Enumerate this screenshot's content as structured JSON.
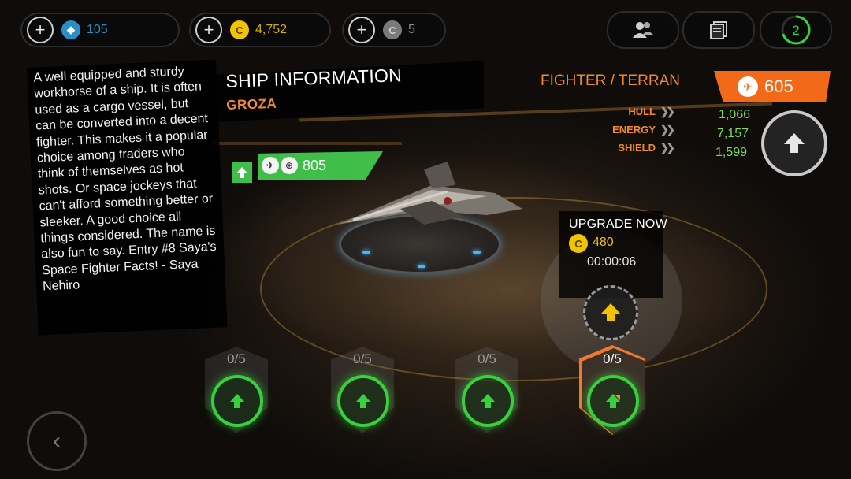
{
  "currencies": [
    {
      "name": "crystal",
      "value": "105",
      "color": "#2a8fc9",
      "icon": "crystal-icon"
    },
    {
      "name": "credits",
      "value": "4,752",
      "color": "#f2c300",
      "icon": "credit-coin-icon"
    },
    {
      "name": "tokens",
      "value": "5",
      "color": "#bdbdbd",
      "icon": "token-icon"
    }
  ],
  "top_icons": {
    "friends_icon": "friends-icon",
    "cards_icon": "cards-icon",
    "level": "2",
    "level_progress": 0.7
  },
  "description": "A well equipped and sturdy workhorse of a ship. It is often used as a cargo vessel, but can be converted into a decent fighter. This makes it a popular choice among traders who think of themselves as hot shots. Or space jockeys that can't afford something better or sleeker. A good choice all things considered. The name is also fun to say. Entry #8 Saya's Space Fighter Facts! - Saya Nehiro",
  "ship_info": {
    "title": "SHIP INFORMATION",
    "name": "GROZA",
    "rating": "805"
  },
  "ship_class": {
    "label": "FIGHTER / TERRAN",
    "power": "605",
    "accent": "#f26a17"
  },
  "stats": [
    {
      "label": "HULL",
      "value": "1,066"
    },
    {
      "label": "ENERGY",
      "value": "7,157"
    },
    {
      "label": "SHIELD",
      "value": "1,599"
    }
  ],
  "upgrade": {
    "title": "UPGRADE NOW",
    "cost": "480",
    "timer": "00:00:06"
  },
  "slots": [
    {
      "count": "0/5",
      "active": false
    },
    {
      "count": "0/5",
      "active": false
    },
    {
      "count": "0/5",
      "active": false
    },
    {
      "count": "0/5",
      "active": true
    }
  ],
  "colors": {
    "green": "#3fbf4a",
    "orange": "#f08a2c",
    "stat_value": "#7dd957"
  }
}
